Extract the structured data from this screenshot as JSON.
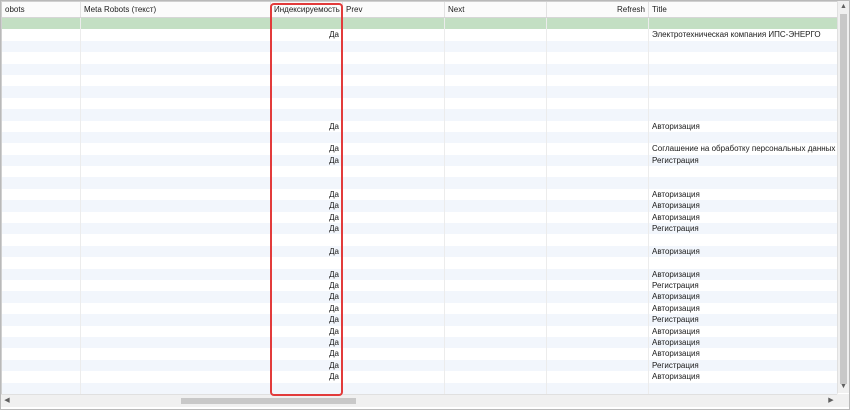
{
  "columns": [
    "obots",
    "Meta Robots (текст)",
    "Индексируемость",
    "Prev",
    "Next",
    "Refresh",
    "Title"
  ],
  "rows": [
    {
      "idx": "",
      "title": ""
    },
    {
      "idx": "Да",
      "title": "Электротехническая компания ИПС-ЭНЕРГО"
    },
    {
      "idx": "",
      "title": ""
    },
    {
      "idx": "",
      "title": ""
    },
    {
      "idx": "",
      "title": ""
    },
    {
      "idx": "",
      "title": ""
    },
    {
      "idx": "",
      "title": ""
    },
    {
      "idx": "",
      "title": ""
    },
    {
      "idx": "",
      "title": ""
    },
    {
      "idx": "Да",
      "title": "Авторизация"
    },
    {
      "idx": "",
      "title": ""
    },
    {
      "idx": "Да",
      "title": "Соглашение на обработку персональных данных"
    },
    {
      "idx": "Да",
      "title": "Регистрация"
    },
    {
      "idx": "",
      "title": ""
    },
    {
      "idx": "",
      "title": ""
    },
    {
      "idx": "Да",
      "title": "Авторизация"
    },
    {
      "idx": "Да",
      "title": "Авторизация"
    },
    {
      "idx": "Да",
      "title": "Авторизация"
    },
    {
      "idx": "Да",
      "title": "Регистрация"
    },
    {
      "idx": "",
      "title": ""
    },
    {
      "idx": "Да",
      "title": "Авторизация"
    },
    {
      "idx": "",
      "title": ""
    },
    {
      "idx": "Да",
      "title": "Авторизация"
    },
    {
      "idx": "Да",
      "title": "Регистрация"
    },
    {
      "idx": "Да",
      "title": "Авторизация"
    },
    {
      "idx": "Да",
      "title": "Авторизация"
    },
    {
      "idx": "Да",
      "title": "Регистрация"
    },
    {
      "idx": "Да",
      "title": "Авторизация"
    },
    {
      "idx": "Да",
      "title": "Авторизация"
    },
    {
      "idx": "Да",
      "title": "Авторизация"
    },
    {
      "idx": "Да",
      "title": "Регистрация"
    },
    {
      "idx": "Да",
      "title": "Авторизация"
    },
    {
      "idx": "",
      "title": ""
    }
  ],
  "selected_row": 0,
  "scrollbar": {
    "up_arrow": "▲",
    "down_arrow": "▼",
    "left_arrow": "◀",
    "right_arrow": "▶"
  },
  "colors": {
    "selection": "#c3dfc3",
    "highlight_border": "#e23b3b",
    "alt_row": "#f2f6fc"
  }
}
